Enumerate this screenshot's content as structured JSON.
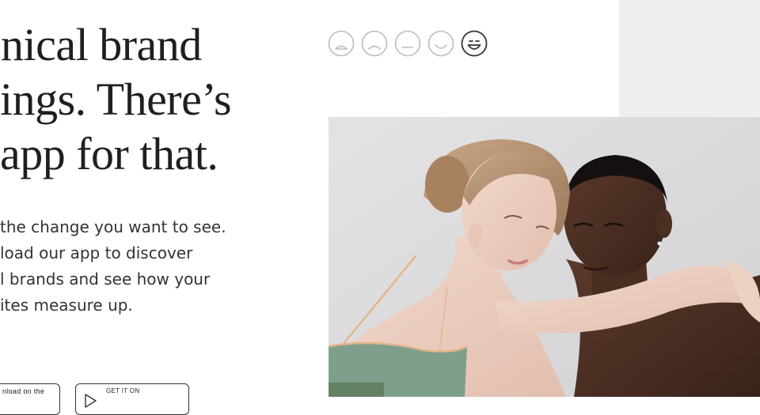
{
  "headline": {
    "line1": "nical brand",
    "line2": "ings. There’s",
    "line3": "app for that."
  },
  "body": {
    "line1": "the change you want to see.",
    "line2": "load our app to discover",
    "line3": "l brands and see how your",
    "line4": "ites measure up."
  },
  "store_buttons": {
    "apple_small": "nload on the",
    "google_small": "GET IT ON"
  },
  "rating_scale": {
    "faces": [
      "very-sad-face-icon",
      "sad-face-icon",
      "neutral-face-icon",
      "smile-face-icon",
      "big-smile-face-icon"
    ],
    "selected_index": 4
  },
  "colors": {
    "text_dark": "#1f1f1f",
    "panel_grey": "#efefef",
    "face_inactive": "#bdbdbd",
    "face_active": "#333333",
    "top_green": "#7f9f8d",
    "strap_peach": "#e4b58a"
  }
}
